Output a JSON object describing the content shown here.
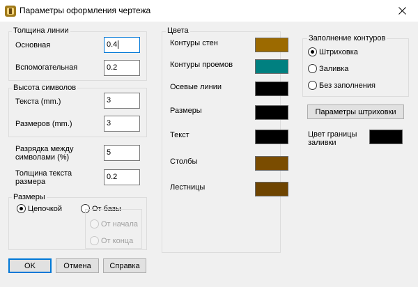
{
  "window": {
    "title": "Параметры оформления чертежа",
    "close_icon": "close-icon"
  },
  "line_thickness": {
    "legend": "Толщина линии",
    "main_label": "Основная",
    "main_value": "0.4",
    "aux_label": "Вспомогательная",
    "aux_value": "0.2"
  },
  "char_height": {
    "legend": "Высота символов",
    "text_label": "Текста (mm.)",
    "text_value": "3",
    "dims_label": "Размеров (mm.)",
    "dims_value": "3"
  },
  "spacing": {
    "label": "Разрядка между символами (%)",
    "value": "5"
  },
  "dim_text_thickness": {
    "label": "Толщина текста размера",
    "value": "0.2"
  },
  "dimensions": {
    "legend": "Размеры",
    "chain": "Цепочкой",
    "from_base": "От базы",
    "from_start": "От начала",
    "from_end": "От конца"
  },
  "colors": {
    "legend": "Цвета",
    "items": [
      {
        "label": "Контуры стен",
        "color": "#9c6a00"
      },
      {
        "label": "Контуры проемов",
        "color": "#008080"
      },
      {
        "label": "Осевые линии",
        "color": "#000000"
      },
      {
        "label": "Размеры",
        "color": "#000000"
      },
      {
        "label": "Текст",
        "color": "#000000"
      },
      {
        "label": "Столбы",
        "color": "#7a4c00"
      },
      {
        "label": "Лестницы",
        "color": "#6e4400"
      }
    ]
  },
  "fill": {
    "legend": "Заполнение контуров",
    "hatch": "Штриховка",
    "solid": "Заливка",
    "none": "Без заполнения",
    "hatch_params": "Параметры штриховки",
    "border_color_label": "Цвет границы заливки",
    "border_color": "#000000"
  },
  "buttons": {
    "ok": "OK",
    "cancel": "Отмена",
    "help": "Справка"
  }
}
